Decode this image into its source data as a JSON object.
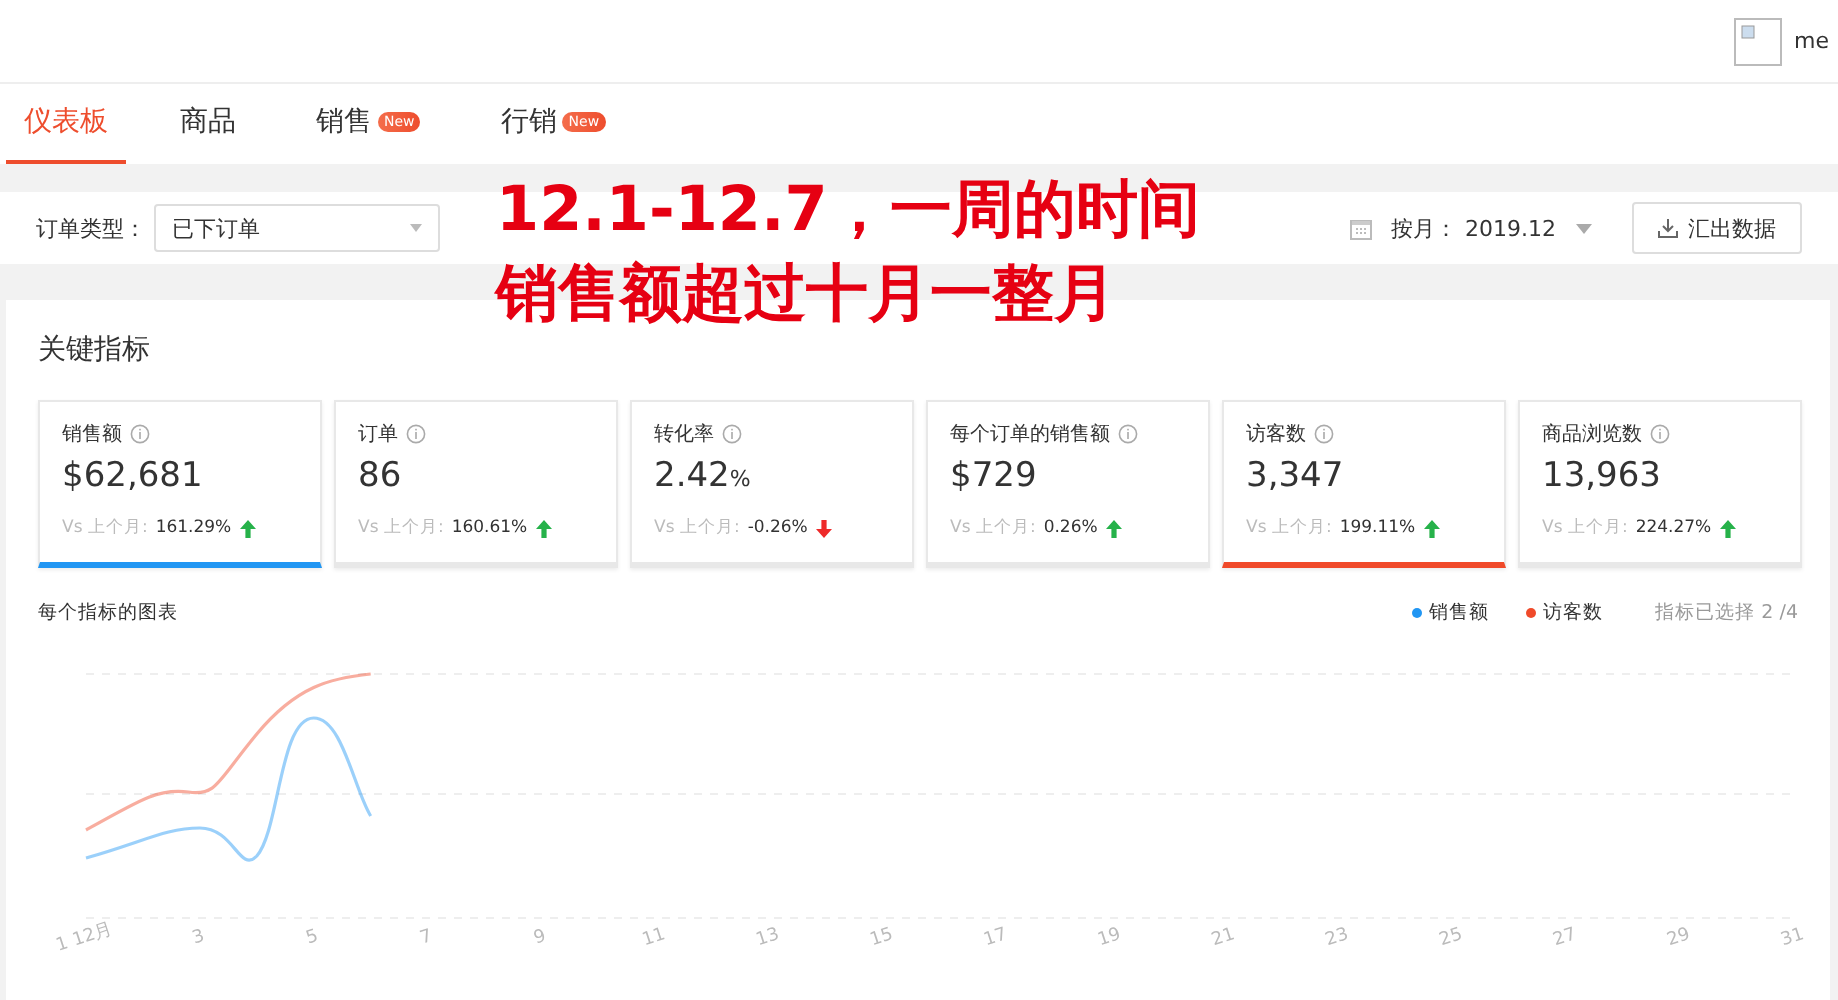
{
  "header": {
    "user_name": "me"
  },
  "tabs": [
    {
      "label": "仪表板",
      "selected": true
    },
    {
      "label": "商品",
      "selected": false
    },
    {
      "label": "销售",
      "selected": false,
      "badge": "New"
    },
    {
      "label": "行销",
      "selected": false,
      "badge": "New"
    }
  ],
  "filters": {
    "order_type_label": "订单类型：",
    "order_type_value": "已下订单",
    "month_label": "按月：",
    "month_value": "2019.12",
    "export_button": "汇出数据"
  },
  "overlay_caption": [
    "12.1-12.7，一周的时间",
    "销售额超过十月一整月"
  ],
  "key_metrics": {
    "title": "关键指标",
    "items": [
      {
        "label": "销售额",
        "value": "$62,681",
        "compare_label": "Vs 上个月:",
        "change": "161.29%",
        "increase": true,
        "selected": true,
        "color": "#2196f3"
      },
      {
        "label": "订单",
        "value": "86",
        "compare_label": "Vs 上个月:",
        "change": "160.61%",
        "increase": true,
        "selected": false
      },
      {
        "label": "转化率",
        "value": "2.42",
        "unit": "%",
        "compare_label": "Vs 上个月:",
        "change": "-0.26%",
        "increase": false,
        "selected": false
      },
      {
        "label": "每个订单的销售额",
        "value": "$729",
        "compare_label": "Vs 上个月:",
        "change": "0.26%",
        "increase": true,
        "selected": false
      },
      {
        "label": "访客数",
        "value": "3,347",
        "compare_label": "Vs 上个月:",
        "change": "199.11%",
        "increase": true,
        "selected": true,
        "color": "#f04a2a"
      },
      {
        "label": "商品浏览数",
        "value": "13,963",
        "compare_label": "Vs 上个月:",
        "change": "224.27%",
        "increase": true,
        "selected": false
      }
    ]
  },
  "chart": {
    "title": "每个指标的图表",
    "legend": [
      {
        "label": "销售额",
        "color": "#2196f3"
      },
      {
        "label": "访客数",
        "color": "#f04a2a"
      }
    ],
    "selection_count": "指标已选择 2 /4",
    "x_labels": [
      "1 12月",
      "3",
      "5",
      "7",
      "9",
      "11",
      "13",
      "15",
      "17",
      "19",
      "21",
      "23",
      "25",
      "27",
      "29",
      "31"
    ]
  }
}
